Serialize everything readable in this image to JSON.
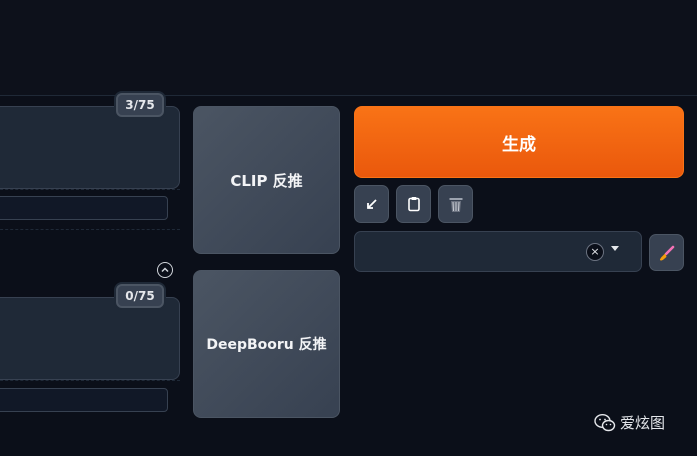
{
  "prompt": {
    "token_counter": "3/75"
  },
  "negative_prompt": {
    "token_counter": "0/75"
  },
  "interrogate": {
    "clip_label": "CLIP 反推",
    "deepbooru_label": "DeepBooru 反推"
  },
  "generate": {
    "label": "生成"
  },
  "tools": {
    "icons": [
      "arrow-down-left-icon",
      "clipboard-icon",
      "trash-icon",
      "paintbrush-icon"
    ]
  },
  "styles": {
    "clear_icon": "×"
  },
  "watermark": {
    "text": "爱炫图"
  },
  "colors": {
    "accent": "#f97316",
    "background": "#0b0f19",
    "panel": "#1f2937"
  }
}
